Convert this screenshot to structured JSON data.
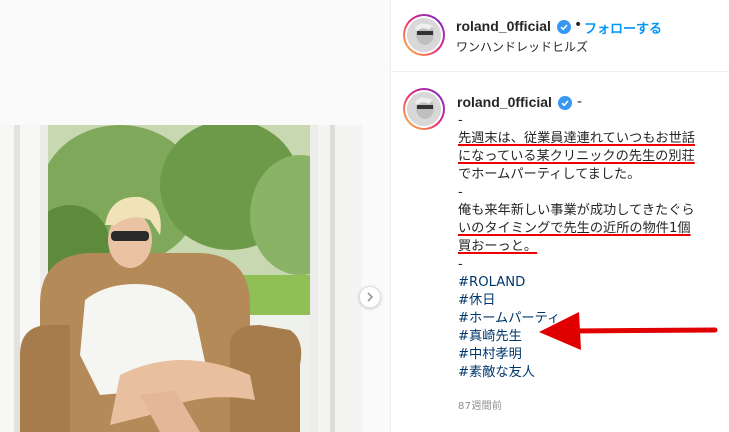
{
  "header": {
    "username": "roland_0fficial",
    "separator": "•",
    "follow_label": "フォローする",
    "location": "ワンハンドレッドヒルズ"
  },
  "caption": {
    "username": "roland_0fficial",
    "username_suffix": "-",
    "lines": [
      "-",
      "先週末は、従業員達連れていつもお世話",
      "になっている某クリニックの先生の別荘",
      "でホームパーティしてました。",
      "-",
      "俺も来年新しい事業が成功してきたぐら",
      "いのタイミングで先生の近所の物件1個",
      "買おーっと。",
      "-"
    ],
    "hashtags": [
      "#ROLAND",
      "#休日",
      "#ホームパーティ",
      "#真崎先生",
      "#中村孝明",
      "#素敵な友人"
    ]
  },
  "timestamp": "87週間前",
  "colors": {
    "accent": "#0095f6",
    "hashtag": "#00376b",
    "annotation": "#e00000",
    "verified": "#3897f0"
  },
  "icons": [
    "verified-icon",
    "chevron-right-icon"
  ]
}
